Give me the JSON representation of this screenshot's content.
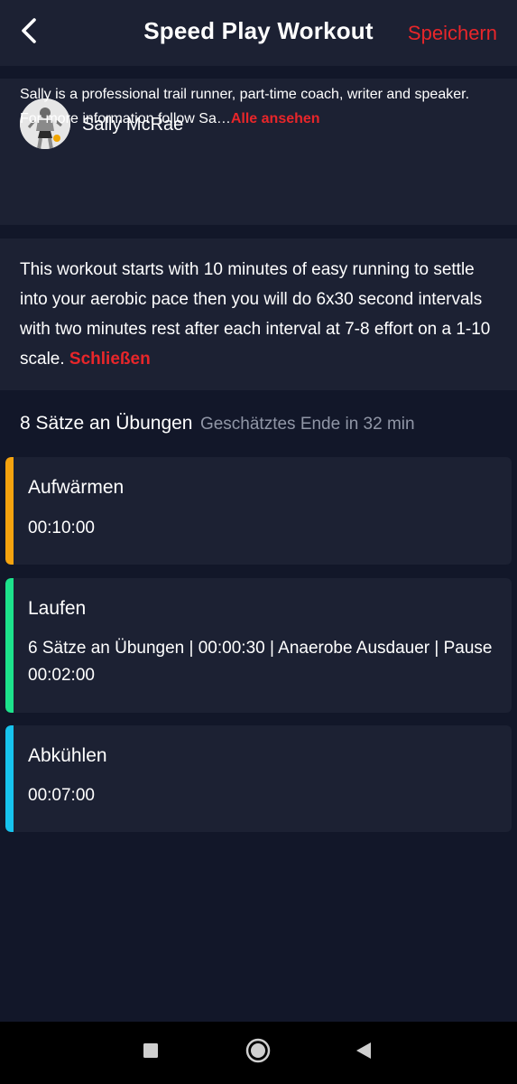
{
  "header": {
    "title": "Speed Play Workout",
    "save_label": "Speichern"
  },
  "coach": {
    "name": "Sally McRae",
    "bio": "Sally is a professional trail runner, part-time coach, writer and speaker. For more information follow Sa…",
    "see_all_label": "Alle ansehen"
  },
  "description": {
    "text": "This workout starts with 10 minutes of easy running to settle into your aerobic pace then you will do 6x30 second intervals with two minutes rest after each interval at 7-8 effort on a 1-10 scale.",
    "close_label": "Schließen"
  },
  "sets": {
    "title": "8 Sätze an Übungen",
    "estimate": "Geschätztes Ende in 32 min"
  },
  "exercises": [
    {
      "title": "Aufwärmen",
      "detail": "00:10:00",
      "color": "#f5a30f"
    },
    {
      "title": "Laufen",
      "detail": "6 Sätze an Übungen | 00:00:30 | Anaerobe Ausdauer | Pause 00:02:00",
      "color": "#1de28c"
    },
    {
      "title": "Abkühlen",
      "detail": "00:07:00",
      "color": "#17c3ee"
    }
  ],
  "colors": {
    "accent": "#e8262a",
    "background": "#121729",
    "card": "#1c2133"
  },
  "navbar": {
    "icons": [
      "recents-square-icon",
      "home-circle-icon",
      "back-triangle-icon"
    ]
  }
}
